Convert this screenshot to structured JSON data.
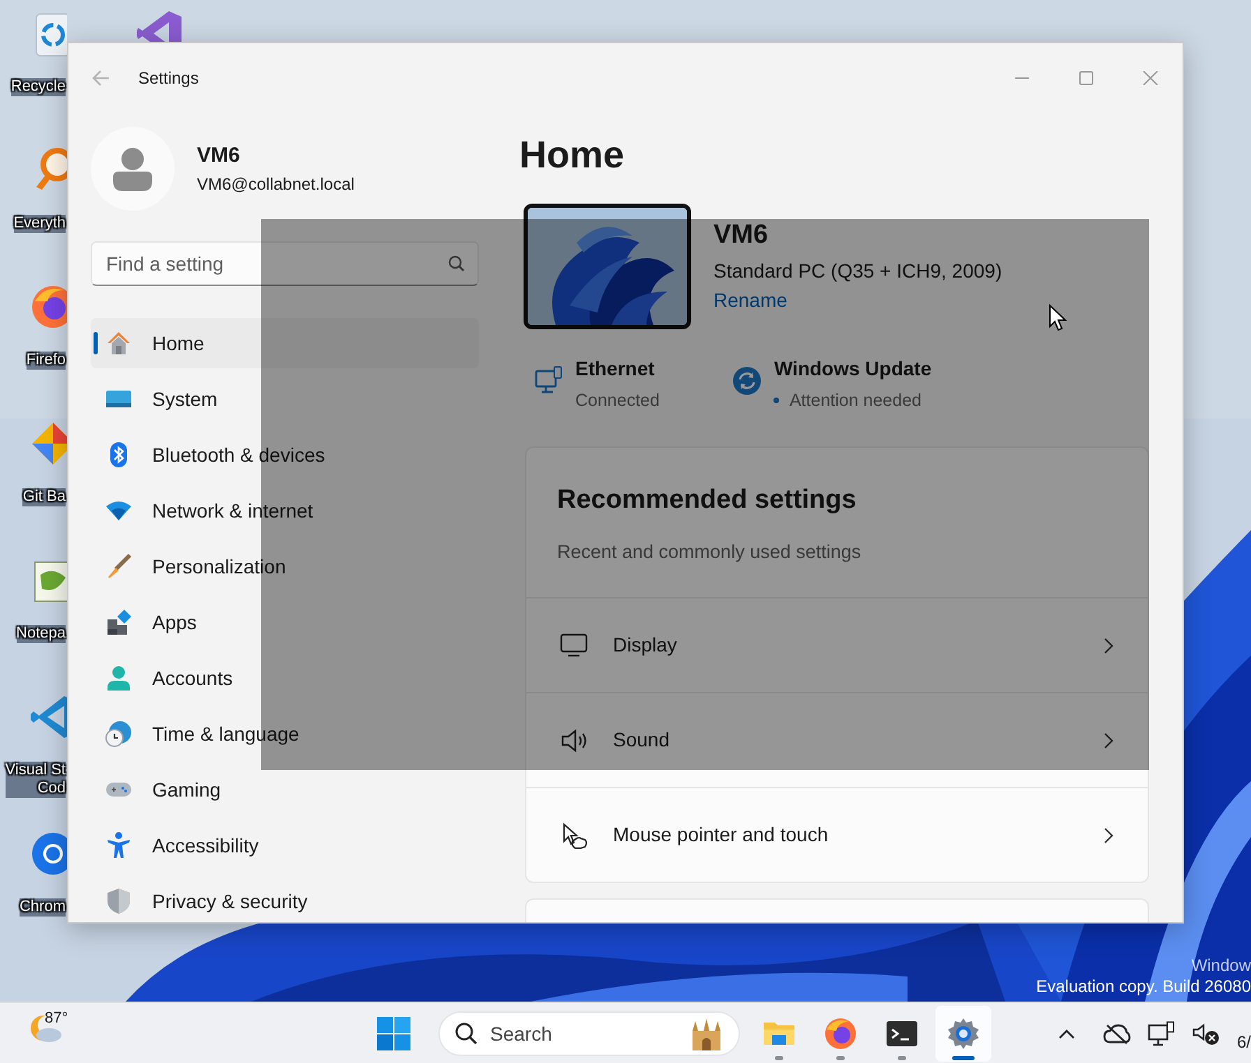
{
  "desktop": {
    "icons": [
      {
        "kind": "recycle-bin",
        "label": "Recycle"
      },
      {
        "kind": "search-app",
        "label": "Everyth"
      },
      {
        "kind": "firefox",
        "label": "Firefo"
      },
      {
        "kind": "git",
        "label": "Git Ba"
      },
      {
        "kind": "notepad",
        "label": "Notepa"
      },
      {
        "kind": "vscode",
        "label": "Visual St\nCod"
      },
      {
        "kind": "chrome",
        "label": "Chrom"
      },
      {
        "kind": "visual-studio"
      }
    ],
    "watermark": [
      "Window",
      "Evaluation copy. Build 26080"
    ]
  },
  "window": {
    "title": "Settings",
    "profile": {
      "name": "VM6",
      "email": "VM6@collabnet.local"
    },
    "search": {
      "placeholder": "Find a setting"
    },
    "nav": [
      {
        "kind": "home",
        "label": "Home",
        "selected": true
      },
      {
        "kind": "system",
        "label": "System",
        "selected": false
      },
      {
        "kind": "bluetooth",
        "label": "Bluetooth & devices",
        "selected": false
      },
      {
        "kind": "network",
        "label": "Network & internet",
        "selected": false
      },
      {
        "kind": "personalization",
        "label": "Personalization",
        "selected": false
      },
      {
        "kind": "apps",
        "label": "Apps",
        "selected": false
      },
      {
        "kind": "accounts",
        "label": "Accounts",
        "selected": false
      },
      {
        "kind": "time",
        "label": "Time & language",
        "selected": false
      },
      {
        "kind": "gaming",
        "label": "Gaming",
        "selected": false
      },
      {
        "kind": "accessibility",
        "label": "Accessibility",
        "selected": false
      },
      {
        "kind": "privacy",
        "label": "Privacy & security",
        "selected": false
      }
    ],
    "page_title": "Home",
    "device": {
      "name": "VM6",
      "model": "Standard PC (Q35 + ICH9, 2009)",
      "action": "Rename"
    },
    "status": [
      {
        "kind": "ethernet",
        "title": "Ethernet",
        "detail": "Connected"
      },
      {
        "kind": "update",
        "title": "Windows Update",
        "detail": "Attention needed"
      }
    ],
    "recommended": {
      "title": "Recommended settings",
      "subtitle": "Recent and commonly used settings",
      "items": [
        {
          "kind": "display",
          "label": "Display"
        },
        {
          "kind": "sound",
          "label": "Sound"
        },
        {
          "kind": "pointer",
          "label": "Mouse pointer and touch"
        }
      ]
    }
  },
  "taskbar": {
    "weather": "87°",
    "search": {
      "placeholder": "Search"
    },
    "apps": [
      {
        "kind": "explorer",
        "active": false
      },
      {
        "kind": "firefox",
        "active": false
      },
      {
        "kind": "terminal",
        "active": false
      },
      {
        "kind": "settings",
        "active": true
      }
    ],
    "clock": "6/"
  }
}
